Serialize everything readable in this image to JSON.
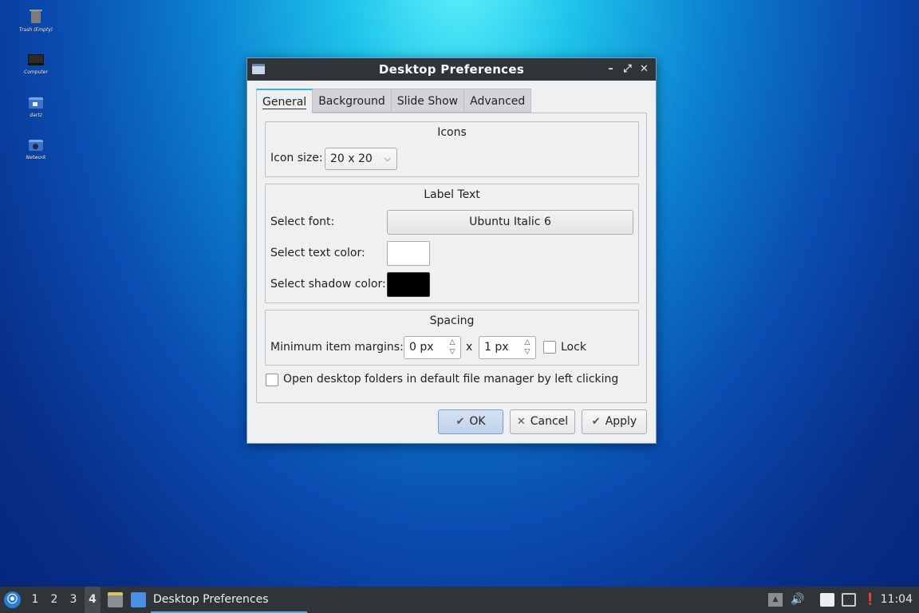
{
  "desktop": {
    "icons": [
      {
        "label": "Trash (Empty)",
        "icon": "trash-icon"
      },
      {
        "label": "Computer",
        "icon": "computer-icon"
      },
      {
        "label": "dartz",
        "icon": "home-folder-icon"
      },
      {
        "label": "Network",
        "icon": "network-icon"
      }
    ]
  },
  "window": {
    "title": "Desktop Preferences",
    "controls": {
      "minimize": "–",
      "maximize": "⤢",
      "close": "✕"
    },
    "tabs": [
      {
        "label": "General",
        "active": true
      },
      {
        "label": "Background",
        "active": false
      },
      {
        "label": "Slide Show",
        "active": false
      },
      {
        "label": "Advanced",
        "active": false
      }
    ],
    "icons_group": {
      "title": "Icons",
      "icon_size_label": "Icon size:",
      "icon_size_value": "20 x 20"
    },
    "label_text_group": {
      "title": "Label Text",
      "font_label": "Select font:",
      "font_value": "Ubuntu Italic 6",
      "text_color_label": "Select text color:",
      "text_color": "#ffffff",
      "shadow_color_label": "Select shadow color:",
      "shadow_color": "#000000"
    },
    "spacing_group": {
      "title": "Spacing",
      "margins_label": "Minimum item margins:",
      "margin_x": "0 px",
      "separator": "x",
      "margin_y": "1 px",
      "lock_label": "Lock",
      "lock_checked": false
    },
    "open_folders_label": "Open desktop folders in default file manager by left clicking",
    "open_folders_checked": false,
    "buttons": {
      "ok": "OK",
      "cancel": "Cancel",
      "apply": "Apply"
    }
  },
  "taskbar": {
    "workspaces": [
      "1",
      "2",
      "3",
      "4"
    ],
    "active_workspace": "4",
    "task": "Desktop Preferences",
    "clock": "11:04"
  },
  "colors": {
    "accent": "#3daee9",
    "titlebar": "#2f3438"
  }
}
